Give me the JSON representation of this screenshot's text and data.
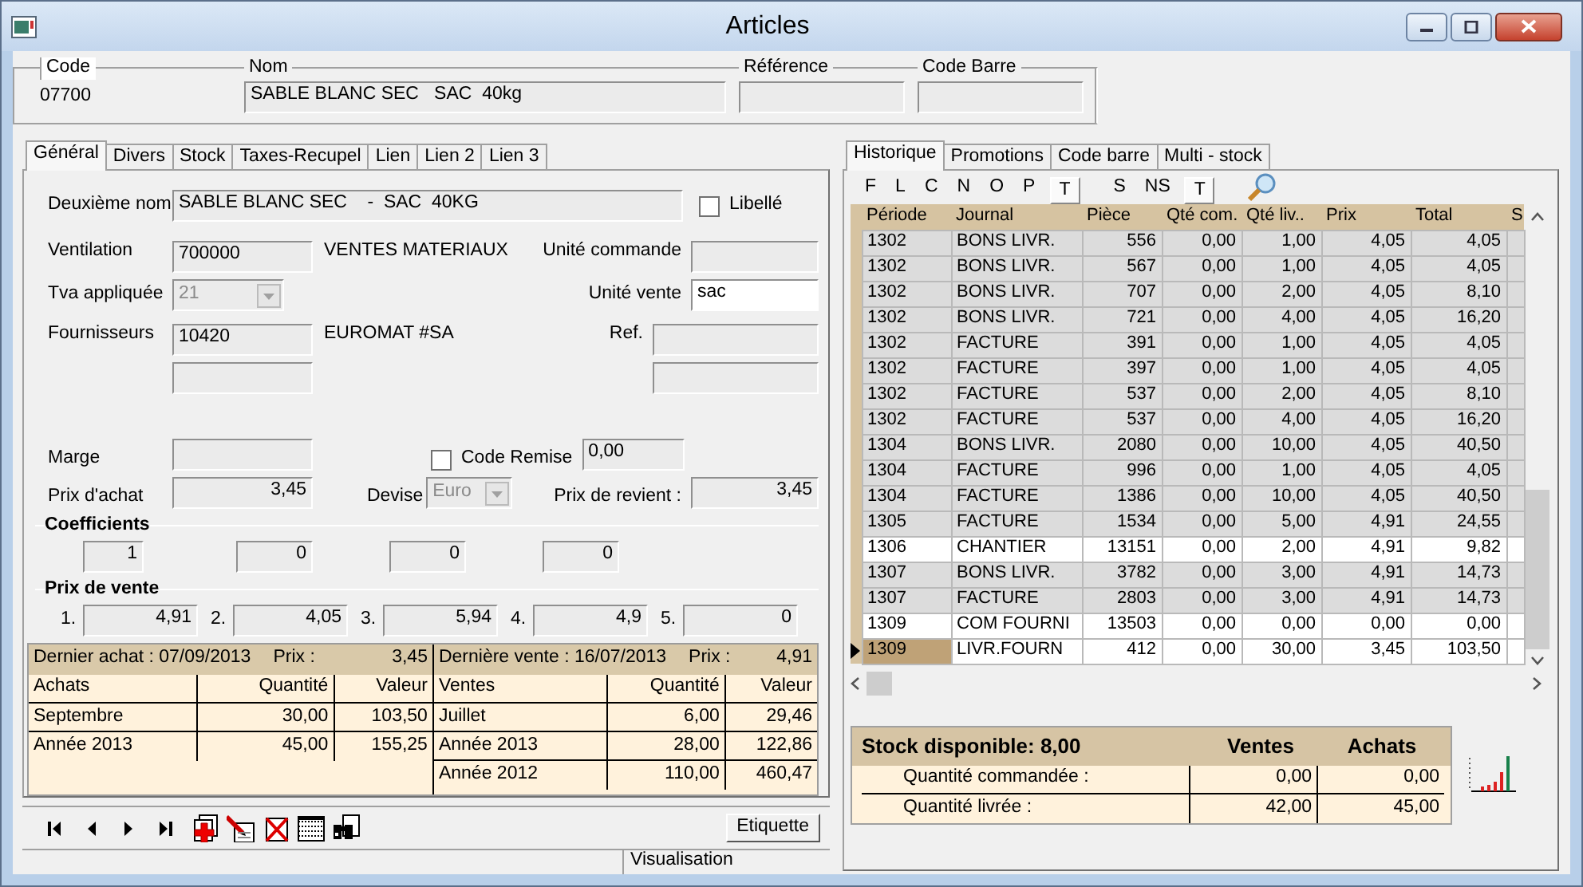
{
  "window": {
    "title": "Articles"
  },
  "header": {
    "fields": [
      {
        "label": "Code",
        "value": "07700",
        "kind": "plain"
      },
      {
        "label": "Nom",
        "value": "SABLE BLANC SEC   SAC  40kg",
        "kind": "field"
      },
      {
        "label": "Référence",
        "kind": "field"
      },
      {
        "label": "Code Barre",
        "kind": "field"
      }
    ]
  },
  "left_tabs": [
    {
      "label": "Général",
      "selected": true
    },
    {
      "label": "Divers",
      "selected": false
    },
    {
      "label": "Stock",
      "selected": false
    },
    {
      "label": "Taxes-Recupel",
      "selected": false
    },
    {
      "label": "Lien",
      "selected": false
    },
    {
      "label": "Lien 2",
      "selected": false
    },
    {
      "label": "Lien 3",
      "selected": false
    }
  ],
  "general": {
    "second_name": {
      "label": "Deuxième nom",
      "value": "SABLE BLANC SEC    -  SAC  40KG"
    },
    "libelle": {
      "label": "Libellé",
      "checked": false
    },
    "ventilation": {
      "label": "Ventilation",
      "value": "700000",
      "description": "VENTES MATERIAUX"
    },
    "unite_commande": {
      "label": "Unité commande"
    },
    "tva": {
      "label": "Tva appliquée",
      "value": "21",
      "disabled": true
    },
    "unite_vente": {
      "label": "Unité vente",
      "value": "sac"
    },
    "fournisseurs": {
      "label": "Fournisseurs",
      "value": "10420",
      "description": "EUROMAT #SA"
    },
    "ref": {
      "label": "Ref."
    },
    "marge": {
      "label": "Marge"
    },
    "code_remise": {
      "label": "Code Remise",
      "checked": false,
      "value": "0,00"
    },
    "prix_achat": {
      "label": "Prix d'achat",
      "value": "3,45"
    },
    "devise": {
      "label": "Devise",
      "value": "Euro",
      "disabled": true
    },
    "prix_revient": {
      "label": "Prix de revient :",
      "value": "3,45"
    },
    "coefficients": {
      "title": "Coefficients",
      "values": [
        "1",
        "0",
        "0",
        "0"
      ]
    },
    "prix_vente": {
      "title": "Prix de vente",
      "items": [
        {
          "label": "1.",
          "value": "4,91"
        },
        {
          "label": "2.",
          "value": "4,05"
        },
        {
          "label": "3.",
          "value": "5,94"
        },
        {
          "label": "4.",
          "value": "4,9"
        },
        {
          "label": "5.",
          "value": "0"
        }
      ]
    }
  },
  "summary": [
    {
      "caption": "Dernier achat : 07/09/2013",
      "price_label": "Prix :",
      "price": "3,45",
      "columns": [
        "Achats",
        "Quantité",
        "Valeur"
      ],
      "rows": [
        [
          "Septembre",
          "30,00",
          "103,50"
        ],
        [
          "Année 2013",
          "45,00",
          "155,25"
        ]
      ]
    },
    {
      "caption": "Dernière vente : 16/07/2013",
      "price_label": "Prix :",
      "price": "4,91",
      "columns": [
        "Ventes",
        "Quantité",
        "Valeur"
      ],
      "rows": [
        [
          "Juillet",
          "6,00",
          "29,46"
        ],
        [
          "Année 2013",
          "28,00",
          "122,86"
        ],
        [
          "Année 2012",
          "110,00",
          "460,47"
        ]
      ]
    }
  ],
  "toolbar": {
    "button": "Etiquette"
  },
  "status_bar": {
    "mode": "Visualisation"
  },
  "right_tabs": [
    {
      "label": "Historique",
      "selected": true
    },
    {
      "label": "Promotions",
      "selected": false
    },
    {
      "label": "Code barre",
      "selected": false
    },
    {
      "label": "Multi - stock",
      "selected": false
    }
  ],
  "filters": [
    [
      {
        "label": "F",
        "selected": false
      },
      {
        "label": "L",
        "selected": false
      },
      {
        "label": "C",
        "selected": false
      },
      {
        "label": "N",
        "selected": false
      },
      {
        "label": "O",
        "selected": false
      },
      {
        "label": "P",
        "selected": false
      },
      {
        "label": "T",
        "selected": true
      }
    ],
    [
      {
        "label": "S",
        "selected": false
      },
      {
        "label": "NS",
        "selected": false
      },
      {
        "label": "T",
        "selected": true
      }
    ]
  ],
  "history": {
    "columns": [
      "Période",
      "Journal",
      "Pièce",
      "Qté com.",
      "Qté liv..",
      "Prix",
      "Total",
      "S"
    ],
    "rows": [
      {
        "cells": [
          "1302",
          "BONS LIVR.",
          "556",
          "0,00",
          "1,00",
          "4,05",
          "4,05"
        ],
        "shaded": true,
        "selected": false
      },
      {
        "cells": [
          "1302",
          "BONS LIVR.",
          "567",
          "0,00",
          "1,00",
          "4,05",
          "4,05"
        ],
        "shaded": true,
        "selected": false
      },
      {
        "cells": [
          "1302",
          "BONS LIVR.",
          "707",
          "0,00",
          "2,00",
          "4,05",
          "8,10"
        ],
        "shaded": true,
        "selected": false
      },
      {
        "cells": [
          "1302",
          "BONS LIVR.",
          "721",
          "0,00",
          "4,00",
          "4,05",
          "16,20"
        ],
        "shaded": true,
        "selected": false
      },
      {
        "cells": [
          "1302",
          "FACTURE",
          "391",
          "0,00",
          "1,00",
          "4,05",
          "4,05"
        ],
        "shaded": true,
        "selected": false
      },
      {
        "cells": [
          "1302",
          "FACTURE",
          "397",
          "0,00",
          "1,00",
          "4,05",
          "4,05"
        ],
        "shaded": true,
        "selected": false
      },
      {
        "cells": [
          "1302",
          "FACTURE",
          "537",
          "0,00",
          "2,00",
          "4,05",
          "8,10"
        ],
        "shaded": true,
        "selected": false
      },
      {
        "cells": [
          "1302",
          "FACTURE",
          "537",
          "0,00",
          "4,00",
          "4,05",
          "16,20"
        ],
        "shaded": true,
        "selected": false
      },
      {
        "cells": [
          "1304",
          "BONS LIVR.",
          "2080",
          "0,00",
          "10,00",
          "4,05",
          "40,50"
        ],
        "shaded": true,
        "selected": false
      },
      {
        "cells": [
          "1304",
          "FACTURE",
          "996",
          "0,00",
          "1,00",
          "4,05",
          "4,05"
        ],
        "shaded": true,
        "selected": false
      },
      {
        "cells": [
          "1304",
          "FACTURE",
          "1386",
          "0,00",
          "10,00",
          "4,05",
          "40,50"
        ],
        "shaded": true,
        "selected": false
      },
      {
        "cells": [
          "1305",
          "FACTURE",
          "1534",
          "0,00",
          "5,00",
          "4,91",
          "24,55"
        ],
        "shaded": true,
        "selected": false
      },
      {
        "cells": [
          "1306",
          "CHANTIER",
          "13151",
          "0,00",
          "2,00",
          "4,91",
          "9,82"
        ],
        "shaded": false,
        "selected": false
      },
      {
        "cells": [
          "1307",
          "BONS LIVR.",
          "3782",
          "0,00",
          "3,00",
          "4,91",
          "14,73"
        ],
        "shaded": true,
        "selected": false
      },
      {
        "cells": [
          "1307",
          "FACTURE",
          "2803",
          "0,00",
          "3,00",
          "4,91",
          "14,73"
        ],
        "shaded": true,
        "selected": false
      },
      {
        "cells": [
          "1309",
          "COM FOURNI",
          "13503",
          "0,00",
          "0,00",
          "0,00",
          "0,00"
        ],
        "shaded": false,
        "selected": false
      },
      {
        "cells": [
          "1309",
          "LIVR.FOURN",
          "412",
          "0,00",
          "30,00",
          "3,45",
          "103,50"
        ],
        "shaded": false,
        "selected": true
      }
    ]
  },
  "stock": {
    "caption": "Stock disponible:  8,00",
    "columns": [
      "Ventes",
      "Achats"
    ],
    "rows": [
      {
        "label": "Quantité commandée :",
        "values": [
          "0,00",
          "0,00"
        ]
      },
      {
        "label": "Quantité livrée :",
        "values": [
          "42,00",
          "45,00"
        ]
      }
    ]
  }
}
